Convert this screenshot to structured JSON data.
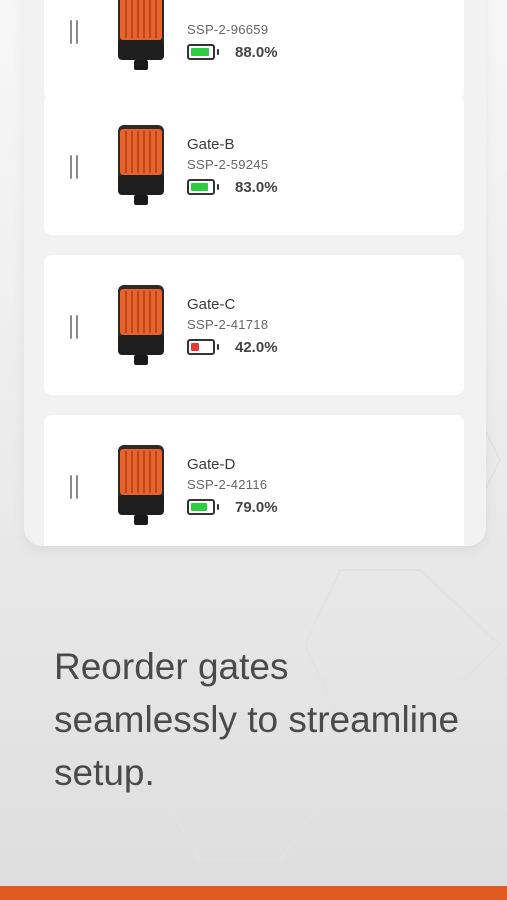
{
  "gates": [
    {
      "name": "",
      "serial": "SSP-2-96659",
      "battery_percent": 88,
      "battery_label": "88.0%",
      "battery_color": "#2ecc40"
    },
    {
      "name": "Gate-B",
      "serial": "SSP-2-59245",
      "battery_percent": 83,
      "battery_label": "83.0%",
      "battery_color": "#2ecc40"
    },
    {
      "name": "Gate-C",
      "serial": "SSP-2-41718",
      "battery_percent": 42,
      "battery_label": "42.0%",
      "battery_color": "#e53935"
    },
    {
      "name": "Gate-D",
      "serial": "SSP-2-42116",
      "battery_percent": 79,
      "battery_label": "79.0%",
      "battery_color": "#2ecc40"
    }
  ],
  "tagline": "Reorder gates seamlessly to streamline setup.",
  "accent_color": "#e0591f"
}
